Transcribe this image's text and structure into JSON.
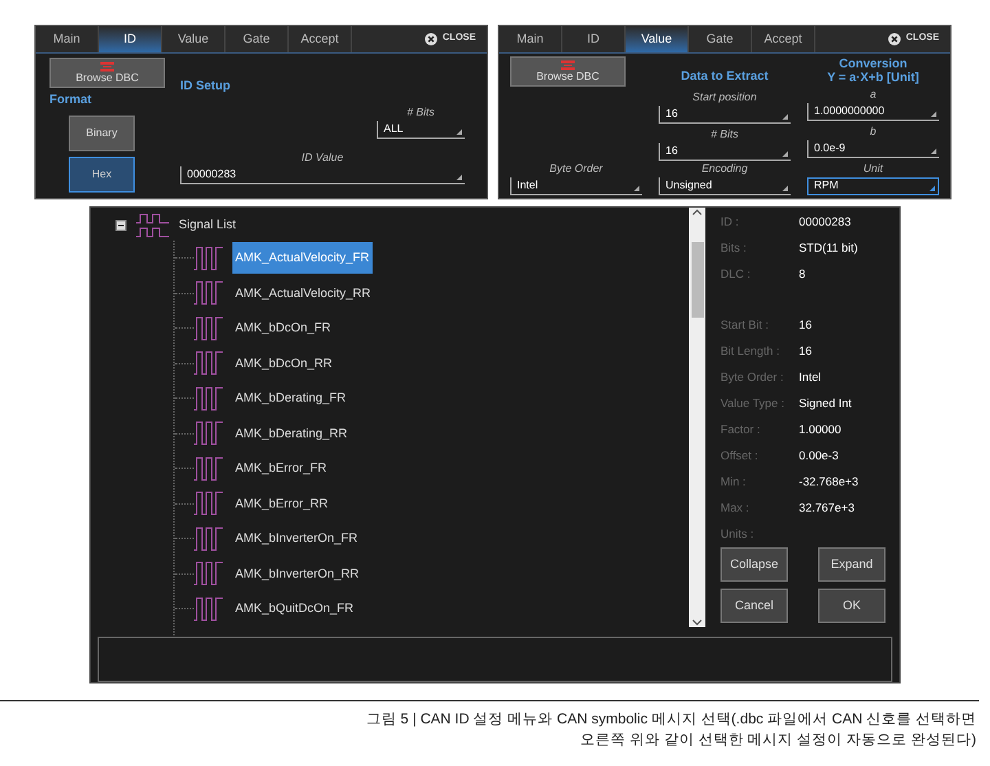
{
  "id_panel": {
    "tabs": [
      {
        "label": "Main",
        "selected": false
      },
      {
        "label": "ID",
        "selected": true
      },
      {
        "label": "Value",
        "selected": false
      },
      {
        "label": "Gate",
        "selected": false
      },
      {
        "label": "Accept",
        "selected": false
      }
    ],
    "close": "CLOSE",
    "browse_button": "Browse DBC",
    "format_label": "Format",
    "format_buttons": [
      {
        "label": "Binary",
        "selected": false
      },
      {
        "label": "Hex",
        "selected": true
      }
    ],
    "section_title": "ID Setup",
    "fields": [
      {
        "label": "# Bits",
        "value": "ALL"
      },
      {
        "label": "ID Value",
        "value": "00000283"
      }
    ]
  },
  "value_panel": {
    "tabs": [
      {
        "label": "Main",
        "selected": false
      },
      {
        "label": "ID",
        "selected": false
      },
      {
        "label": "Value",
        "selected": true
      },
      {
        "label": "Gate",
        "selected": false
      },
      {
        "label": "Accept",
        "selected": false
      }
    ],
    "close": "CLOSE",
    "browse_button": "Browse DBC",
    "extract_title": "Data to Extract",
    "conversion_title": "Conversion",
    "conversion_formula": "Y = a·X+b [Unit]",
    "extract_fields": [
      {
        "label": "Start position",
        "value": "16"
      },
      {
        "label": "# Bits",
        "value": "16"
      }
    ],
    "conversion_fields": [
      {
        "label": "a",
        "value": "1.0000000000"
      },
      {
        "label": "b",
        "value": "0.0e-9"
      }
    ],
    "bottom_fields": [
      {
        "label": "Byte Order",
        "value": "Intel",
        "focused": false
      },
      {
        "label": "Encoding",
        "value": "Unsigned",
        "focused": false
      },
      {
        "label": "Unit",
        "value": "RPM",
        "focused": true
      }
    ]
  },
  "signal_dialog": {
    "root": {
      "label": "Signal List",
      "expanded": true,
      "children": [
        {
          "label": "AMK_ActualVelocity_FR",
          "selected": true
        },
        {
          "label": "AMK_ActualVelocity_RR",
          "selected": false
        },
        {
          "label": "AMK_bDcOn_FR",
          "selected": false
        },
        {
          "label": "AMK_bDcOn_RR",
          "selected": false
        },
        {
          "label": "AMK_bDerating_FR",
          "selected": false
        },
        {
          "label": "AMK_bDerating_RR",
          "selected": false
        },
        {
          "label": "AMK_bError_FR",
          "selected": false
        },
        {
          "label": "AMK_bError_RR",
          "selected": false
        },
        {
          "label": "AMK_bInverterOn_FR",
          "selected": false
        },
        {
          "label": "AMK_bInverterOn_RR",
          "selected": false
        },
        {
          "label": "AMK_bQuitDcOn_FR",
          "selected": false
        }
      ]
    },
    "message_details": [
      {
        "label": "ID :",
        "value": "00000283"
      },
      {
        "label": "Bits :",
        "value": "STD(11 bit)"
      },
      {
        "label": "DLC :",
        "value": "8"
      }
    ],
    "signal_details": [
      {
        "label": "Start Bit :",
        "value": "16"
      },
      {
        "label": "Bit Length :",
        "value": "16"
      },
      {
        "label": "Byte Order :",
        "value": "Intel"
      },
      {
        "label": "Value Type :",
        "value": "Signed Int"
      },
      {
        "label": "Factor :",
        "value": "1.00000"
      },
      {
        "label": "Offset :",
        "value": "0.00e-3"
      },
      {
        "label": "Min :",
        "value": "-32.768e+3"
      },
      {
        "label": "Max :",
        "value": "32.767e+3"
      },
      {
        "label": "Units :"
      }
    ],
    "buttons": [
      "Collapse",
      "Expand",
      "Cancel",
      "OK"
    ]
  },
  "caption": [
    "그림 5 | CAN ID 설정 메뉴와 CAN symbolic 메시지 선택(.dbc 파일에서 CAN 신호를 선택하면",
    "오른쪽 위와 같이 선택한 메시지 설정이 자동으로 완성된다)"
  ]
}
